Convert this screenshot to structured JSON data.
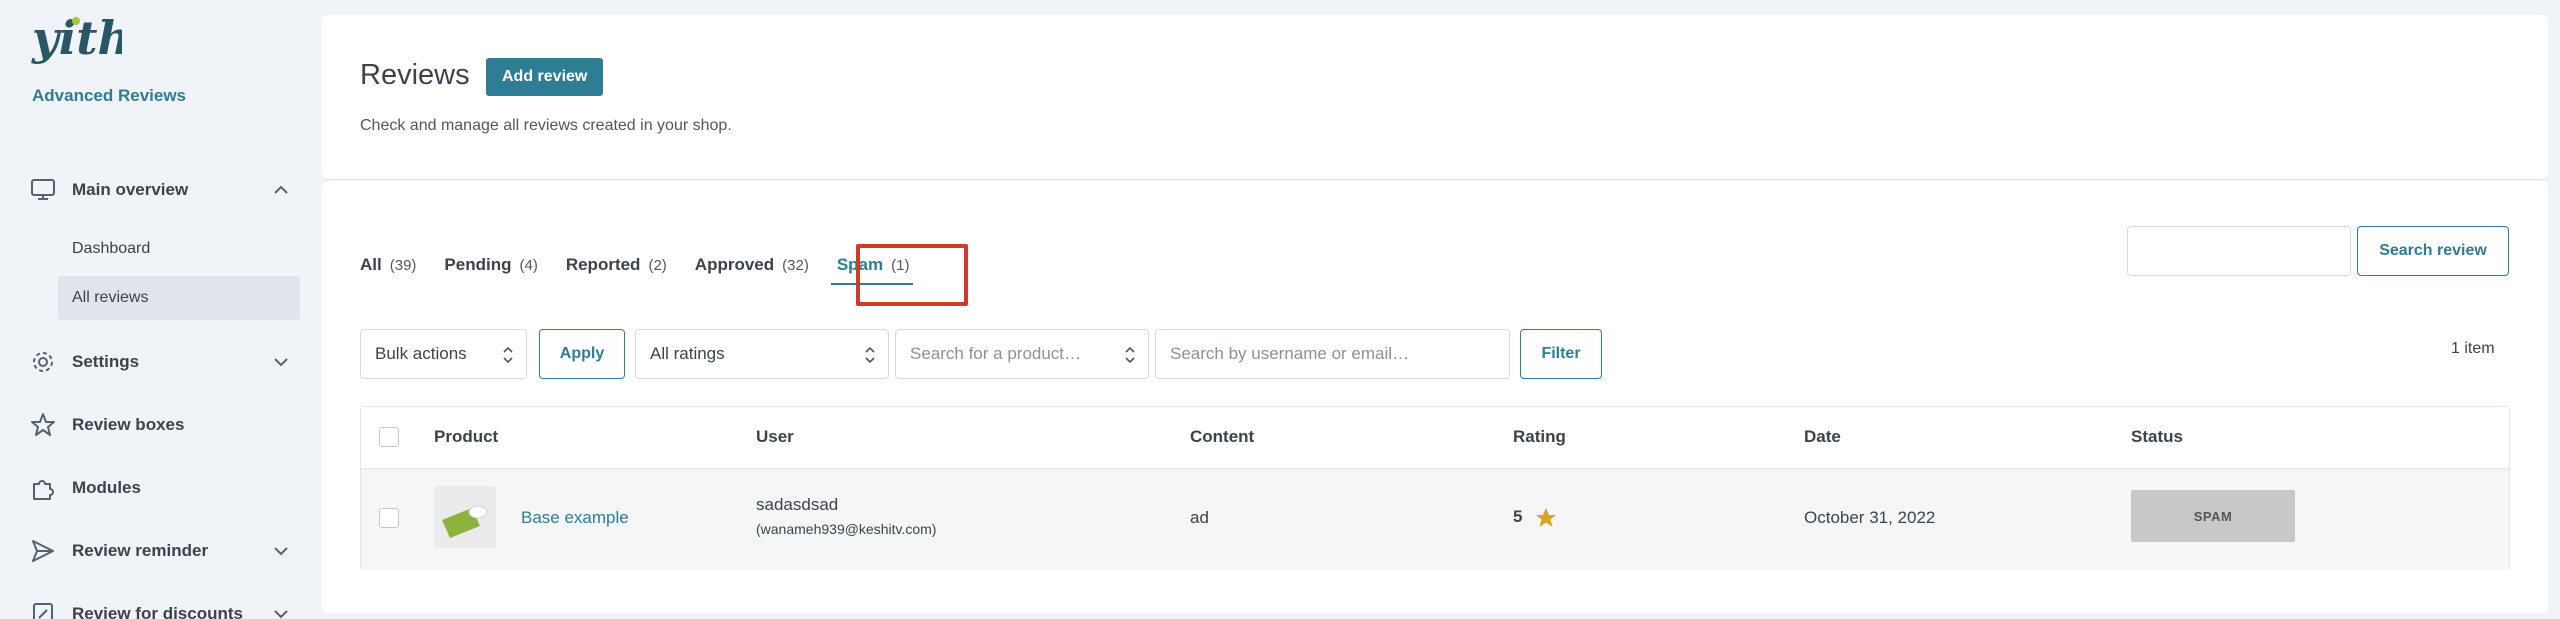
{
  "brand": {
    "logo_text": "yith",
    "name": "Advanced Reviews"
  },
  "sidebar": {
    "items": [
      {
        "label": "Main overview",
        "icon": "monitor-icon",
        "chevron": "up"
      },
      {
        "label": "Dashboard"
      },
      {
        "label": "All reviews",
        "active": true
      },
      {
        "label": "Settings",
        "icon": "gear-icon",
        "chevron": "down"
      },
      {
        "label": "Review boxes",
        "icon": "star-outline-icon"
      },
      {
        "label": "Modules",
        "icon": "puzzle-icon"
      },
      {
        "label": "Review reminder",
        "icon": "send-icon",
        "chevron": "down"
      },
      {
        "label": "Review for discounts",
        "icon": "discount-icon",
        "chevron": "down"
      }
    ]
  },
  "header": {
    "title": "Reviews",
    "add_button": "Add review",
    "description": "Check and manage all reviews created in your shop."
  },
  "tabs": [
    {
      "label": "All",
      "count": "(39)"
    },
    {
      "label": "Pending",
      "count": "(4)"
    },
    {
      "label": "Reported",
      "count": "(2)"
    },
    {
      "label": "Approved",
      "count": "(32)"
    },
    {
      "label": "Spam",
      "count": "(1)",
      "active": true
    }
  ],
  "search": {
    "value": "",
    "button": "Search review"
  },
  "filters": {
    "bulk_actions": "Bulk actions",
    "apply": "Apply",
    "ratings": "All ratings",
    "product_placeholder": "Search for a product…",
    "user_placeholder": "Search by username or email…",
    "filter": "Filter",
    "items_count": "1 item"
  },
  "table": {
    "columns": [
      "Product",
      "User",
      "Content",
      "Rating",
      "Date",
      "Status"
    ],
    "rows": [
      {
        "product": "Base example",
        "user_name": "sadasdsad",
        "user_email": "(wanameh939@keshitv.com)",
        "content": "ad",
        "rating": "5",
        "date": "October 31, 2022",
        "status": "SPAM"
      }
    ]
  },
  "colors": {
    "accent": "#2e7d95",
    "highlight": "#d0392b",
    "star": "#d9a520",
    "badge_bg": "#c8c8c8"
  }
}
